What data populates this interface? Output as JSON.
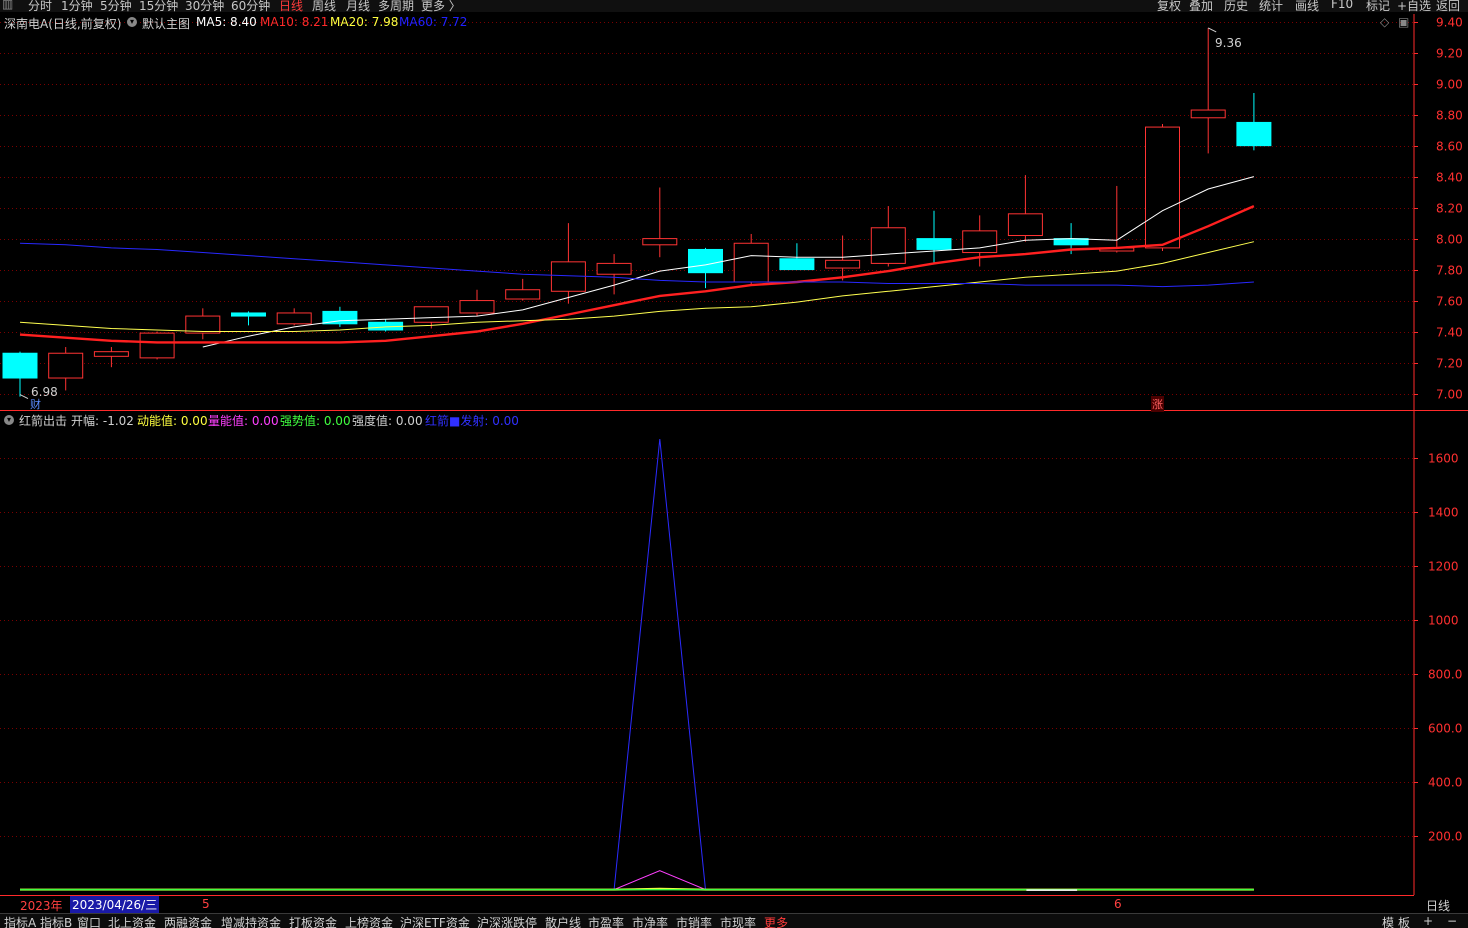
{
  "toolbar": {
    "timeframes": [
      "分时",
      "1分钟",
      "5分钟",
      "15分钟",
      "30分钟",
      "60分钟",
      "日线",
      "周线",
      "月线",
      "多周期",
      "更多 〉"
    ],
    "active_timeframe": "日线",
    "right_buttons": [
      "复权",
      "叠加",
      "历史",
      "统计",
      "画线",
      "F10",
      "标记",
      "+自选",
      "返回"
    ]
  },
  "main_panel": {
    "stock_title": "深南电A(日线,前复权)",
    "template_label": "默认主图",
    "ma_labels": [
      {
        "text": "MA5: 8.40",
        "color": "#ffffff"
      },
      {
        "text": "MA10: 8.21",
        "color": "#ff2a2a"
      },
      {
        "text": "MA20: 7.98",
        "color": "#ffff40"
      },
      {
        "text": "MA60: 7.72",
        "color": "#2020ff"
      }
    ],
    "high_label": "9.36",
    "low_label": "6.98",
    "fin_marker": "财",
    "zhang_marker": "涨"
  },
  "indicator_panel": {
    "name": "红箭出击",
    "params": [
      {
        "text": "开幅: -1.02",
        "color": "#d0d0d0"
      },
      {
        "text": "动能值: 0.00",
        "color": "#ffff40"
      },
      {
        "text": "量能值: 0.00",
        "color": "#ff40ff"
      },
      {
        "text": "强势值: 0.00",
        "color": "#40ff40"
      },
      {
        "text": "强度值: 0.00",
        "color": "#d0d0d0"
      },
      {
        "text": "红箭■发射: 0.00",
        "color": "#3030ff"
      }
    ]
  },
  "date_axis": {
    "year_label": "2023年",
    "cursor_date": "2023/04/26/三",
    "month_ticks": [
      "5",
      "6"
    ],
    "period_label": "日线"
  },
  "bottom_tabs": [
    "指标A",
    "指标B",
    "窗口",
    "北上资金",
    "两融资金",
    "增减持资金",
    "打板资金",
    "上榜资金",
    "沪深ETF资金",
    "沪深涨跌停",
    "散户线",
    "市盈率",
    "市净率",
    "市销率",
    "市现率",
    "更多"
  ],
  "bottom_right": [
    "模",
    "板",
    "+",
    "−"
  ],
  "colors": {
    "up": "#ff3333",
    "down": "#00ffff",
    "ma5": "#ffffff",
    "ma10": "#ff2020",
    "ma20": "#ffff50",
    "ma60": "#2828ff",
    "grid": "#7a0000",
    "axis": "#ff2a2a"
  },
  "chart_data": [
    {
      "type": "candlestick",
      "title": "深南电A(日线,前复权)",
      "ylim": [
        6.9,
        9.45
      ],
      "yticks": [
        7.0,
        7.2,
        7.4,
        7.6,
        7.8,
        8.0,
        8.2,
        8.4,
        8.6,
        8.8,
        9.0,
        9.2,
        9.4
      ],
      "candles": [
        {
          "o": 7.26,
          "h": 7.27,
          "l": 6.98,
          "c": 7.1
        },
        {
          "o": 7.1,
          "h": 7.3,
          "l": 7.02,
          "c": 7.26
        },
        {
          "o": 7.24,
          "h": 7.3,
          "l": 7.17,
          "c": 7.27
        },
        {
          "o": 7.23,
          "h": 7.4,
          "l": 7.22,
          "c": 7.39
        },
        {
          "o": 7.39,
          "h": 7.55,
          "l": 7.35,
          "c": 7.5
        },
        {
          "o": 7.52,
          "h": 7.53,
          "l": 7.44,
          "c": 7.5
        },
        {
          "o": 7.45,
          "h": 7.55,
          "l": 7.44,
          "c": 7.52
        },
        {
          "o": 7.53,
          "h": 7.56,
          "l": 7.43,
          "c": 7.45
        },
        {
          "o": 7.46,
          "h": 7.48,
          "l": 7.4,
          "c": 7.41
        },
        {
          "o": 7.46,
          "h": 7.56,
          "l": 7.42,
          "c": 7.56
        },
        {
          "o": 7.52,
          "h": 7.67,
          "l": 7.5,
          "c": 7.6
        },
        {
          "o": 7.61,
          "h": 7.74,
          "l": 7.6,
          "c": 7.67
        },
        {
          "o": 7.66,
          "h": 8.1,
          "l": 7.58,
          "c": 7.85
        },
        {
          "o": 7.77,
          "h": 7.9,
          "l": 7.64,
          "c": 7.84
        },
        {
          "o": 7.96,
          "h": 8.33,
          "l": 7.88,
          "c": 8.0
        },
        {
          "o": 7.93,
          "h": 7.94,
          "l": 7.68,
          "c": 7.78
        },
        {
          "o": 7.72,
          "h": 8.03,
          "l": 7.7,
          "c": 7.97
        },
        {
          "o": 7.87,
          "h": 7.97,
          "l": 7.8,
          "c": 7.8
        },
        {
          "o": 7.81,
          "h": 8.02,
          "l": 7.73,
          "c": 7.86
        },
        {
          "o": 7.84,
          "h": 8.21,
          "l": 7.82,
          "c": 8.07
        },
        {
          "o": 8.0,
          "h": 8.18,
          "l": 7.84,
          "c": 7.93
        },
        {
          "o": 7.91,
          "h": 8.15,
          "l": 7.82,
          "c": 8.05
        },
        {
          "o": 8.02,
          "h": 8.41,
          "l": 7.98,
          "c": 8.16
        },
        {
          "o": 8.0,
          "h": 8.1,
          "l": 7.9,
          "c": 7.96
        },
        {
          "o": 7.92,
          "h": 8.34,
          "l": 7.91,
          "c": 7.94
        },
        {
          "o": 7.94,
          "h": 8.74,
          "l": 7.92,
          "c": 8.72
        },
        {
          "o": 8.78,
          "h": 9.36,
          "l": 8.55,
          "c": 8.83
        },
        {
          "o": 8.75,
          "h": 8.94,
          "l": 8.57,
          "c": 8.6
        }
      ],
      "series": [
        {
          "name": "MA5",
          "values": [
            null,
            null,
            null,
            null,
            7.3,
            7.37,
            7.43,
            7.47,
            7.48,
            7.49,
            7.5,
            7.54,
            7.62,
            7.7,
            7.79,
            7.83,
            7.89,
            7.88,
            7.88,
            7.9,
            7.92,
            7.94,
            7.99,
            8.0,
            7.99,
            8.18,
            8.32,
            8.4
          ]
        },
        {
          "name": "MA10",
          "values": [
            7.38,
            7.36,
            7.34,
            7.33,
            7.33,
            7.33,
            7.33,
            7.33,
            7.34,
            7.37,
            7.4,
            7.45,
            7.51,
            7.57,
            7.63,
            7.66,
            7.7,
            7.72,
            7.75,
            7.79,
            7.84,
            7.88,
            7.9,
            7.93,
            7.94,
            7.96,
            8.08,
            8.21
          ]
        },
        {
          "name": "MA20",
          "values": [
            7.46,
            7.44,
            7.42,
            7.41,
            7.4,
            7.4,
            7.4,
            7.41,
            7.43,
            7.44,
            7.46,
            7.47,
            7.48,
            7.5,
            7.53,
            7.55,
            7.56,
            7.59,
            7.63,
            7.66,
            7.69,
            7.72,
            7.75,
            7.77,
            7.79,
            7.84,
            7.91,
            7.98
          ]
        },
        {
          "name": "MA60",
          "values": [
            7.97,
            7.96,
            7.94,
            7.93,
            7.91,
            7.89,
            7.87,
            7.85,
            7.83,
            7.81,
            7.79,
            7.77,
            7.76,
            7.75,
            7.73,
            7.72,
            7.72,
            7.72,
            7.72,
            7.71,
            7.71,
            7.71,
            7.7,
            7.7,
            7.7,
            7.69,
            7.7,
            7.72
          ]
        }
      ]
    },
    {
      "type": "line",
      "title": "红箭出击",
      "ylim": [
        -20,
        1770
      ],
      "yticks": [
        200.0,
        400.0,
        600.0,
        800.0,
        1000,
        1200,
        1400,
        1600
      ],
      "series": [
        {
          "name": "红箭■发射",
          "values": [
            0,
            0,
            0,
            0,
            0,
            0,
            0,
            0,
            0,
            0,
            0,
            0,
            0,
            0,
            1670,
            0,
            0,
            0,
            0,
            0,
            0,
            0,
            0,
            0,
            0,
            0,
            0,
            0
          ]
        },
        {
          "name": "量能值",
          "values": [
            0,
            0,
            0,
            0,
            0,
            0,
            0,
            0,
            0,
            0,
            0,
            0,
            0,
            0,
            70,
            0,
            0,
            0,
            0,
            0,
            0,
            0,
            0,
            0,
            0,
            0,
            0,
            0
          ]
        },
        {
          "name": "动能值",
          "values": [
            0,
            0,
            0,
            0,
            0,
            0,
            0,
            0,
            0,
            0,
            0,
            0,
            0,
            0,
            3,
            0,
            0,
            0,
            0,
            0,
            0,
            0,
            0,
            0,
            0,
            0,
            0,
            0
          ]
        },
        {
          "name": "强势值",
          "values": [
            0,
            0,
            0,
            0,
            0,
            0,
            0,
            0,
            0,
            0,
            0,
            0,
            0,
            0,
            0,
            0,
            0,
            0,
            0,
            0,
            0,
            0,
            0,
            0,
            0,
            0,
            0,
            0
          ]
        }
      ]
    }
  ]
}
